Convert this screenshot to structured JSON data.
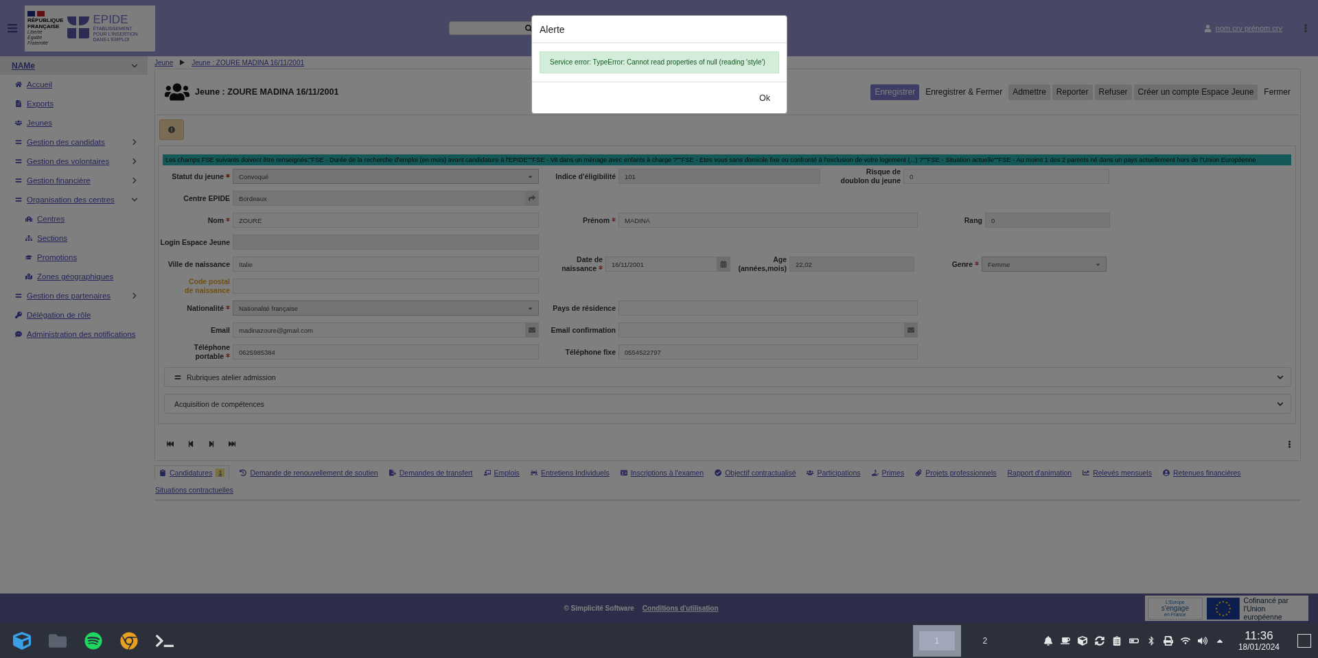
{
  "header": {
    "logo": {
      "republic_lines": [
        "RÉPUBLIQUE",
        "FRANÇAISE"
      ],
      "motto_lines": [
        "Liberté",
        "Égalité",
        "Fraternité"
      ],
      "brand": "EPIDE",
      "brand_subtitle_lines": [
        "ÉTABLISSEMENT",
        "POUR L'INSERTION",
        "DANS L'EMPLOI"
      ]
    },
    "user": "nom crv prénom crv"
  },
  "sidebar": {
    "title": "NAMe",
    "expanded": true,
    "items": [
      {
        "label": "Accueil",
        "kind": "link"
      },
      {
        "label": "Exports",
        "kind": "link"
      },
      {
        "label": "Jeunes",
        "kind": "link"
      },
      {
        "label": "Gestion des candidats",
        "kind": "group",
        "expanded": false
      },
      {
        "label": "Gestion des volontaires",
        "kind": "group",
        "expanded": false
      },
      {
        "label": "Gestion financière",
        "kind": "group",
        "expanded": false
      },
      {
        "label": "Organisation des centres",
        "kind": "group",
        "expanded": true,
        "children": [
          {
            "label": "Centres"
          },
          {
            "label": "Sections"
          },
          {
            "label": "Promotions"
          },
          {
            "label": "Zones géographiques"
          }
        ]
      },
      {
        "label": "Gestion des partenaires",
        "kind": "group",
        "expanded": false
      },
      {
        "label": "Délégation de rôle",
        "kind": "link"
      },
      {
        "label": "Administration des notifications",
        "kind": "link"
      }
    ]
  },
  "breadcrumb": [
    "Jeune",
    "Jeune : ZOURE MADINA 16/11/2001"
  ],
  "record": {
    "title": "Jeune : ZOURE MADINA 16/11/2001",
    "actions": [
      {
        "label": "Enregistrer",
        "kind": "primary"
      },
      {
        "label": "Enregistrer & Fermer",
        "kind": "plain"
      },
      {
        "label": "Admettre",
        "kind": "secondary"
      },
      {
        "label": "Reporter",
        "kind": "secondary"
      },
      {
        "label": "Refuser",
        "kind": "secondary"
      },
      {
        "label": "Créer un compte Espace Jeune",
        "kind": "secondary"
      },
      {
        "label": "Fermer",
        "kind": "plain"
      }
    ],
    "banner": "Les champs FSE suivants doivent être renseignés:\"FSE - Durée de la  recherche d'emploi (en mois) avant candidature à l'EPIDE\"\"FSE - Vit dans un ménage avec enfants à charge ?\"\"FSE - Etes vous sans domicile fixe ou confronté à l'exclusion de votre logement (...) ?\"\"FSE - Situation actuelle\"\"FSE - Au moins 1 des 2 parents né dans un pays actuellement hors de l'Union Européenne",
    "form_rows": [
      {
        "items": [
          {
            "label": "Statut du jeune",
            "required": true,
            "warning": false,
            "kind": "select",
            "value": "Convoqué"
          },
          {
            "label": "Indice d'éligibilité",
            "required": false,
            "warning": false,
            "kind": "readonly",
            "value": "101"
          },
          {
            "label": "Risque de doublon du jeune",
            "required": false,
            "warning": false,
            "kind": "text",
            "value": "0"
          }
        ]
      },
      {
        "items": [
          {
            "label": "Centre EPIDE",
            "required": false,
            "warning": false,
            "kind": "lookup",
            "value": "Bordeaux"
          }
        ]
      },
      {
        "items": [
          {
            "label": "Nom",
            "required": true,
            "warning": false,
            "kind": "text",
            "value": "ZOURE"
          },
          {
            "label": "Prénom",
            "required": true,
            "warning": false,
            "kind": "text",
            "value": "MADINA"
          },
          {
            "label": "Rang",
            "required": false,
            "warning": false,
            "kind": "readonly",
            "value": "0"
          }
        ]
      },
      {
        "items": [
          {
            "label": "Login Espace Jeune",
            "required": false,
            "warning": false,
            "kind": "readonly"
          }
        ]
      },
      {
        "items": [
          {
            "label": "Ville de naissance",
            "required": false,
            "warning": false,
            "kind": "text",
            "value": "Italie"
          },
          {
            "label": "Date de naissance",
            "required": true,
            "warning": false,
            "kind": "date",
            "value": "16/11/2001"
          },
          {
            "label": "Age (années,mois)",
            "required": false,
            "warning": false,
            "kind": "readonly",
            "value": "22,02"
          },
          {
            "label": "Genre",
            "required": true,
            "warning": false,
            "kind": "select",
            "value": "Femme"
          }
        ]
      },
      {
        "items": [
          {
            "label": "Code postal de naissance",
            "required": false,
            "warning": true,
            "kind": "text"
          }
        ]
      },
      {
        "items": [
          {
            "label": "Nationalité",
            "required": true,
            "warning": false,
            "kind": "select",
            "value": "Nationalité française"
          },
          {
            "label": "Pays de résidence",
            "required": false,
            "warning": false,
            "kind": "text"
          }
        ]
      },
      {
        "items": [
          {
            "label": "Email",
            "required": false,
            "warning": false,
            "kind": "email",
            "value": "madinazoure@gmail.com"
          },
          {
            "label": "Email confirmation",
            "required": false,
            "warning": false,
            "kind": "email"
          }
        ]
      },
      {
        "items": [
          {
            "label": "Téléphone portable",
            "required": true,
            "warning": false,
            "kind": "text",
            "value": "0625985384"
          },
          {
            "label": "Téléphone fixe",
            "required": false,
            "warning": false,
            "kind": "text",
            "value": "0554522797"
          }
        ]
      }
    ],
    "sections": [
      {
        "label": "Rubriques atelier admission",
        "kind": "handle",
        "expanded": false
      },
      {
        "label": "Acquisition de compétences",
        "kind": "plain",
        "expanded": false
      }
    ]
  },
  "links": [
    {
      "label": "Candidatures",
      "selected": true,
      "badge": "1"
    },
    {
      "label": "Demande de renouvellement de soutien",
      "selected": false
    },
    {
      "label": "Demandes de transfert",
      "selected": false
    },
    {
      "label": "Emplois",
      "selected": false
    },
    {
      "label": "Entretiens Individuels",
      "selected": false
    },
    {
      "label": "Inscriptions à l'examen",
      "selected": false
    },
    {
      "label": "Objectif contractualisé",
      "selected": false
    },
    {
      "label": "Participations",
      "selected": false
    },
    {
      "label": "Primes",
      "selected": false
    },
    {
      "label": "Projets professionnels",
      "selected": false
    },
    {
      "label": "Rapport d'animation",
      "selected": false
    },
    {
      "label": "Relevés mensuels",
      "selected": false
    },
    {
      "label": "Retenues financières",
      "selected": false
    },
    {
      "label": "Situations contractuelles",
      "selected": false
    }
  ],
  "footer": {
    "copyright": "© Simplicité Software",
    "link": "Conditions d'utilisation",
    "europe_lines": [
      "L'Europe",
      "s'engage",
      "en France"
    ],
    "eu_lines": [
      "Cofinancé par",
      "l'Union européenne"
    ]
  },
  "dialog": {
    "title": "Alerte",
    "message": "Service error: TypeError: Cannot read properties of null (reading 'style')",
    "button": "Ok"
  },
  "taskbar": {
    "workspaces": [
      {
        "label": "1",
        "selected": true
      },
      {
        "label": "2",
        "selected": false
      }
    ],
    "time": "11:36",
    "date": "18/01/2024"
  }
}
